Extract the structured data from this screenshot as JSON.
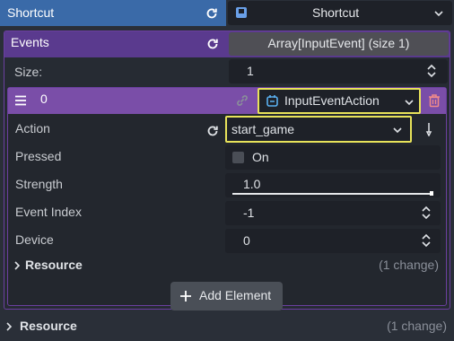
{
  "header": {
    "label": "Shortcut",
    "value": "Shortcut",
    "accent": "#3d6aa6"
  },
  "events": {
    "label": "Events",
    "array_value": "Array[InputEvent] (size 1)",
    "accent": "#6b3fa0",
    "size_label": "Size:",
    "size_value": "1"
  },
  "element": {
    "index": "0",
    "type_value": "InputEventAction",
    "highlight": "#e8e35a",
    "properties": {
      "action_label": "Action",
      "action_value": "start_game",
      "pressed_label": "Pressed",
      "pressed_value": "On",
      "strength_label": "Strength",
      "strength_value": "1.0",
      "strength_fraction": 1.0,
      "event_index_label": "Event Index",
      "event_index_value": "-1",
      "device_label": "Device",
      "device_value": "0"
    },
    "resource": {
      "label": "Resource",
      "changes": "(1 change)"
    }
  },
  "add_element_label": "Add Element",
  "outer_resource": {
    "label": "Resource",
    "changes": "(1 change)"
  }
}
